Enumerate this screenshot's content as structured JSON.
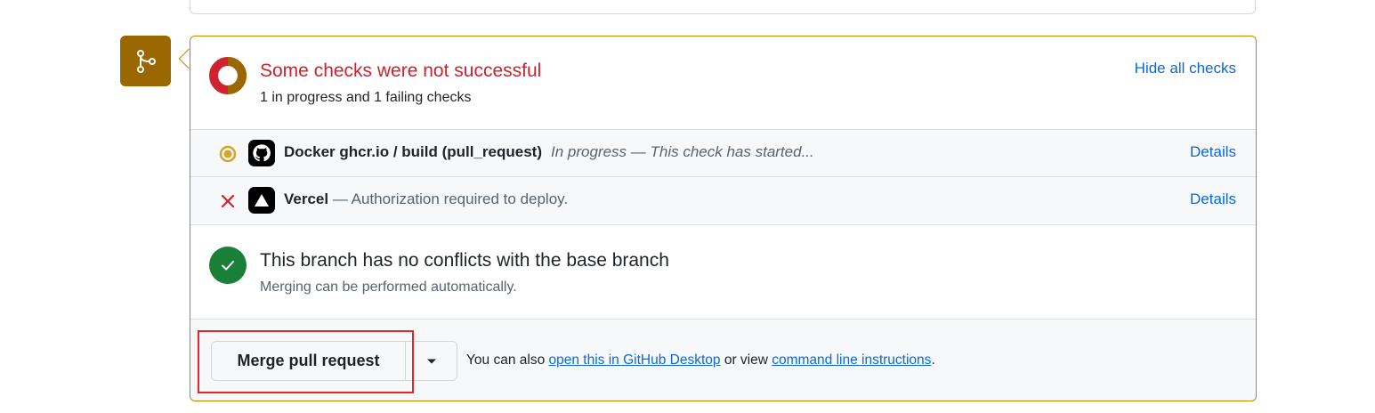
{
  "colors": {
    "accent_border": "#bf8700",
    "badge_bg": "#9a6700",
    "fail_red": "#cf222e",
    "pending_yellow": "#d4a72c",
    "success_green": "#1a7f37",
    "link_blue": "#0969da"
  },
  "merge_badge": {
    "icon": "git-branch-icon"
  },
  "checks_status": {
    "icon": "status-ring-icon",
    "title": "Some checks were not successful",
    "subtitle": "1 in progress and 1 failing checks",
    "hide_link": "Hide all checks"
  },
  "checks": [
    {
      "status_icon": "in-progress-dot-icon",
      "app_icon": "github-icon",
      "name": "Docker ghcr.io / build (pull_request)",
      "description": "In progress — This check has started...",
      "details": "Details"
    },
    {
      "status_icon": "x-icon",
      "app_icon": "vercel-triangle-icon",
      "name": "Vercel",
      "description": " — Authorization required to deploy.",
      "details": "Details"
    }
  ],
  "conflicts": {
    "icon": "check-circle-icon",
    "title": "This branch has no conflicts with the base branch",
    "subtitle": "Merging can be performed automatically."
  },
  "merge": {
    "button_label": "Merge pull request",
    "caret_icon": "caret-down-icon",
    "hint_prefix": "You can also ",
    "desktop_link": "open this in GitHub Desktop",
    "hint_middle": " or view ",
    "cli_link": "command line instructions",
    "hint_suffix": "."
  }
}
